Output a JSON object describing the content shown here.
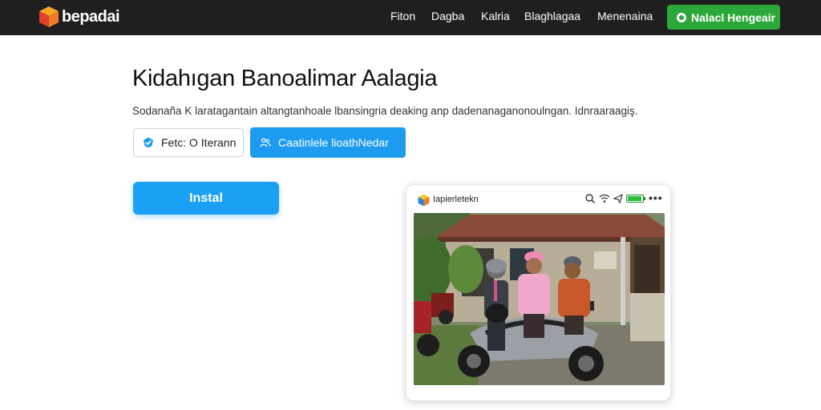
{
  "header": {
    "brand": "bepadai",
    "nav": [
      "Fiton",
      "Dagba",
      "Kalria",
      "Blaghlagaa",
      "Menenaina"
    ],
    "cta_label": "Nalacl Hengeair"
  },
  "hero": {
    "title": "Kidahıgan Banoalimar Aalagia",
    "subtitle": "Sodanaña K laratagantain altangtanhoale lbansingria deaking anp dadenanaganonoulngan. Idnraaraagiş.",
    "secondary_button": "Fetc: O Iterann",
    "primary_button": "Caatinlele lioathNedar",
    "install_button": "Instal"
  },
  "preview": {
    "app_name": "Iapierletekn",
    "battery_color": "#28c03a"
  },
  "colors": {
    "topbar": "#1f1f1f",
    "cta_green": "#2ca83a",
    "accent_blue": "#1d9bf0"
  }
}
